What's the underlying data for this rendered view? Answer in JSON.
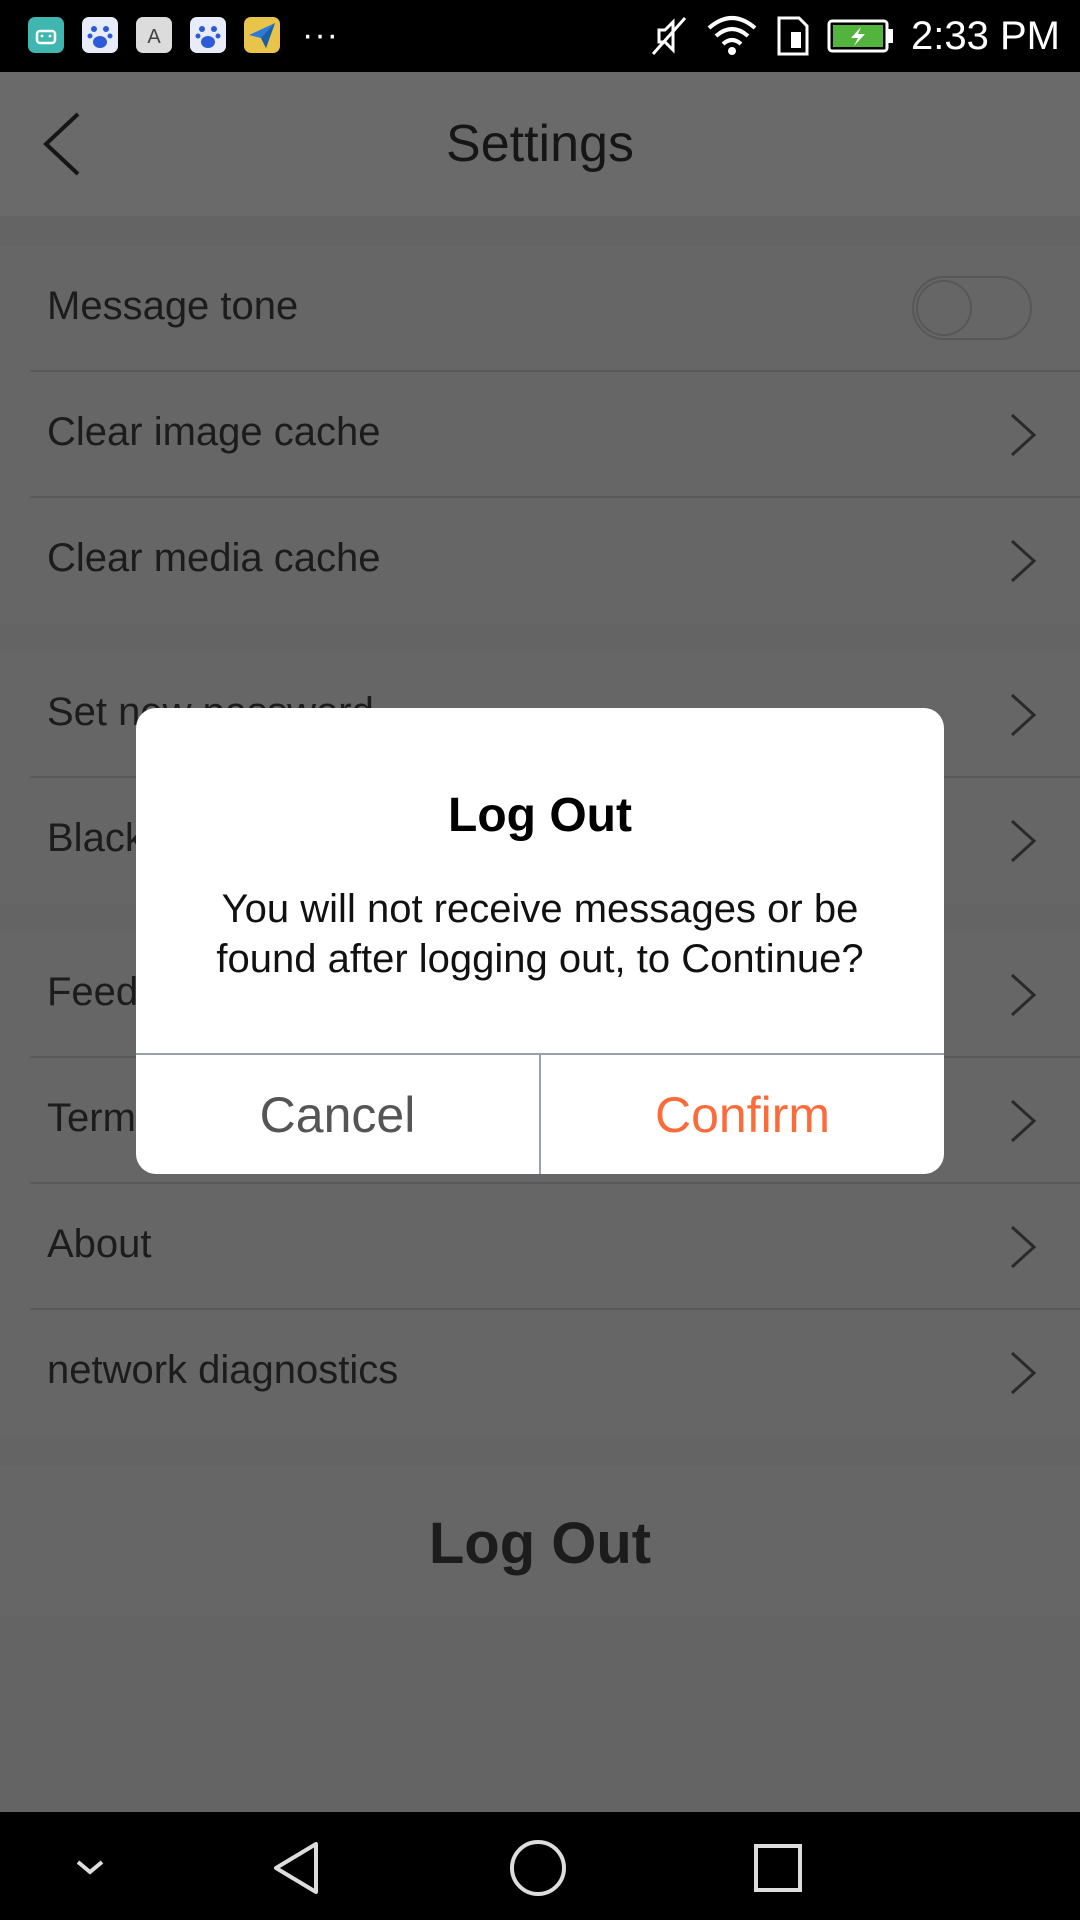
{
  "status_bar": {
    "time": "2:33 PM",
    "more_indicator": "···",
    "notification_icons": [
      "android-icon",
      "baidu-icon",
      "font-icon",
      "baidu-icon",
      "paper-plane-icon"
    ],
    "status_icons": [
      "mute-icon",
      "wifi-icon",
      "sim-icon",
      "battery-charging-icon"
    ],
    "colors": {
      "battery": "#52b43c"
    }
  },
  "header": {
    "title": "Settings",
    "back_icon": "back-arrow-icon"
  },
  "settings": {
    "group1": [
      {
        "label": "Message tone",
        "control": "toggle",
        "toggle_on": false
      },
      {
        "label": "Clear image cache",
        "control": "chevron"
      },
      {
        "label": "Clear media cache",
        "control": "chevron"
      }
    ],
    "group2": [
      {
        "label": "Set new password",
        "control": "chevron"
      },
      {
        "label": "Blacklist",
        "control": "chevron"
      }
    ],
    "group3": [
      {
        "label": "Feedback",
        "control": "chevron"
      },
      {
        "label": "Terms of Service",
        "control": "chevron"
      },
      {
        "label": "About",
        "control": "chevron"
      },
      {
        "label": "network diagnostics",
        "control": "chevron"
      }
    ]
  },
  "logout_button": {
    "label": "Log Out"
  },
  "dialog": {
    "title": "Log Out",
    "message": "You will not receive messages or be found after logging out, to Continue?",
    "cancel_label": "Cancel",
    "confirm_label": "Confirm",
    "colors": {
      "confirm": "#fb6c3b"
    }
  },
  "nav_bar": {
    "items": [
      "chevron-down-icon",
      "back-triangle-icon",
      "home-circle-icon",
      "recents-square-icon"
    ]
  }
}
